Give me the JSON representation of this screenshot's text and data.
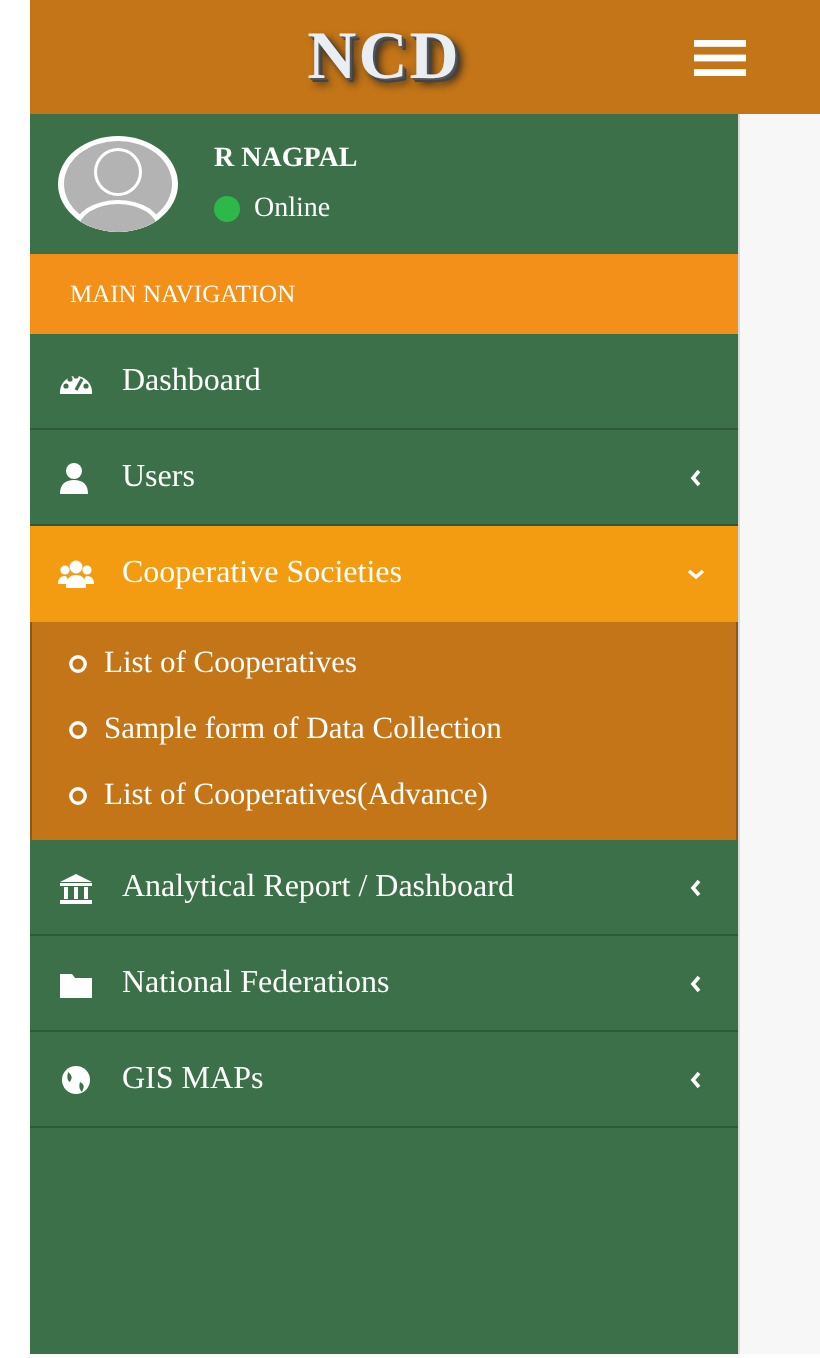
{
  "header": {
    "logo": "NCD"
  },
  "user": {
    "name": "R NAGPAL",
    "status": {
      "text": "Online",
      "color": "#2db84a"
    }
  },
  "nav_heading": "MAIN NAVIGATION",
  "menu": [
    {
      "label": "Dashboard",
      "selected": false
    },
    {
      "label": "Users",
      "selected": false,
      "expanded": false
    },
    {
      "label": "Cooperative Societies",
      "selected": true,
      "expanded": true,
      "children": [
        {
          "label": "List of Cooperatives",
          "selected": false
        },
        {
          "label": "Sample form of Data Collection",
          "selected": false
        },
        {
          "label": "List of Cooperatives(Advance)",
          "selected": false
        }
      ]
    },
    {
      "label": "Analytical Report / Dashboard",
      "selected": false,
      "expanded": false
    },
    {
      "label": "National Federations",
      "selected": false,
      "expanded": false
    },
    {
      "label": "GIS MAPs",
      "selected": false,
      "expanded": false
    }
  ]
}
